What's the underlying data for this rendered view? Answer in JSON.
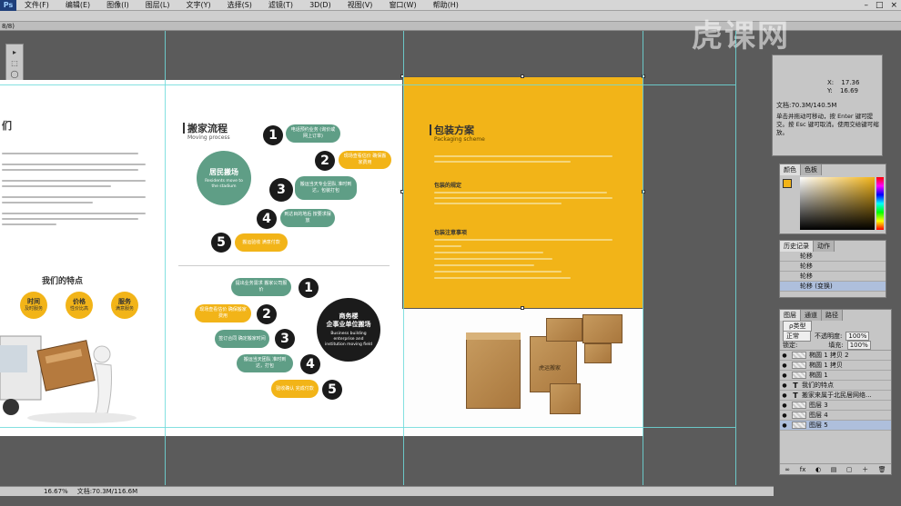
{
  "app": {
    "logo": "Ps"
  },
  "menu": [
    "文件(F)",
    "编辑(E)",
    "图像(I)",
    "图层(L)",
    "文字(Y)",
    "选择(S)",
    "滤镜(T)",
    "3D(D)",
    "视图(V)",
    "窗口(W)",
    "帮助(H)"
  ],
  "window_controls": [
    "–",
    "□",
    "×"
  ],
  "doc_tab": "8/8)",
  "watermark": "虎课网",
  "tools": [
    "▸",
    "⬚",
    "◯",
    "✎",
    "✂",
    "⌖",
    "✚",
    "◐",
    "✐",
    "▭",
    "⬓",
    "◈",
    "T",
    "↖",
    "▢",
    "✋",
    "🔍"
  ],
  "left_page": {
    "heading_partial": "们",
    "features_title": "我们的特点",
    "features": [
      {
        "title": "时间",
        "sub": "及时服务"
      },
      {
        "title": "价格",
        "sub": "性价比高"
      },
      {
        "title": "服务",
        "sub": "满意服务"
      }
    ]
  },
  "middle_page": {
    "title": "搬家流程",
    "subtitle": "Moving process",
    "green_circle_title": "居民搬场",
    "green_circle_sub": "Residents move to the stadium",
    "black_circle_title": "商务楼\n企事业单位搬场",
    "black_circle_sub": "Business building enterprise and institution moving field",
    "steps_top": [
      "1",
      "2",
      "3",
      "4",
      "5"
    ],
    "steps_bottom": [
      "1",
      "2",
      "3",
      "4",
      "5"
    ],
    "pills_top": [
      "电话预约业务\n(询价或网上订单)",
      "现场查看估价\n确保搬家费用",
      "搬运当天专业团队\n准时到达，包装打包",
      "到达目的地后\n按要求摆放",
      "搬运验收\n满意付款"
    ],
    "pills_bottom": [
      "提出业务需求\n搬家公司报价",
      "现场查看估价\n确保搬家费用",
      "签订合同\n确定搬家时间",
      "搬运当天团队\n准时到达，打包",
      "验收确认\n完成付款"
    ]
  },
  "right_page": {
    "title": "包装方案",
    "subtitle": "Packaging scheme",
    "section1": "包装的规定",
    "section2": "包装注意事项",
    "box_brand": "虎运搬家"
  },
  "info_panel": {
    "x_label": "X:",
    "x_value": "17.36",
    "y_label": "Y:",
    "y_value": "16.69",
    "doc_size": "文档:70.3M/140.5M",
    "hint": "单击并拖动可移动，按 Enter 键可提交。按 Esc 键可取消。使用交给键可缩放。"
  },
  "color_panel": {
    "tabs": [
      "颜色",
      "色板"
    ],
    "fg_color": "#f2b418"
  },
  "history_panel": {
    "tabs": [
      "历史记录",
      "动作"
    ],
    "rows": [
      "轮移",
      "轮移",
      "轮移",
      "轮移 (变换)"
    ]
  },
  "layers_panel": {
    "tabs": [
      "图层",
      "通道",
      "路径"
    ],
    "filter": "ρ类型",
    "blend_mode": "正常",
    "opacity_label": "不透明度:",
    "opacity": "100%",
    "lock_label": "锁定:",
    "fill_label": "填充:",
    "fill": "100%",
    "layers": [
      {
        "type": "shape",
        "name": "椭圆 1 拷贝 2"
      },
      {
        "type": "shape",
        "name": "椭圆 1 拷贝"
      },
      {
        "type": "shape",
        "name": "椭圆 1"
      },
      {
        "type": "text",
        "name": "我们的特点"
      },
      {
        "type": "text",
        "name": "搬家来属于北民居网络..."
      },
      {
        "type": "image",
        "name": "图层 3"
      },
      {
        "type": "image",
        "name": "图层 4"
      },
      {
        "type": "image",
        "name": "图层 5"
      }
    ],
    "footer_icons": [
      "∞",
      "fx",
      "◐",
      "▤",
      "▢",
      "＋",
      "🗑"
    ]
  },
  "status_bar": {
    "zoom": "16.67%",
    "doc": "文档:70.3M/116.6M"
  }
}
